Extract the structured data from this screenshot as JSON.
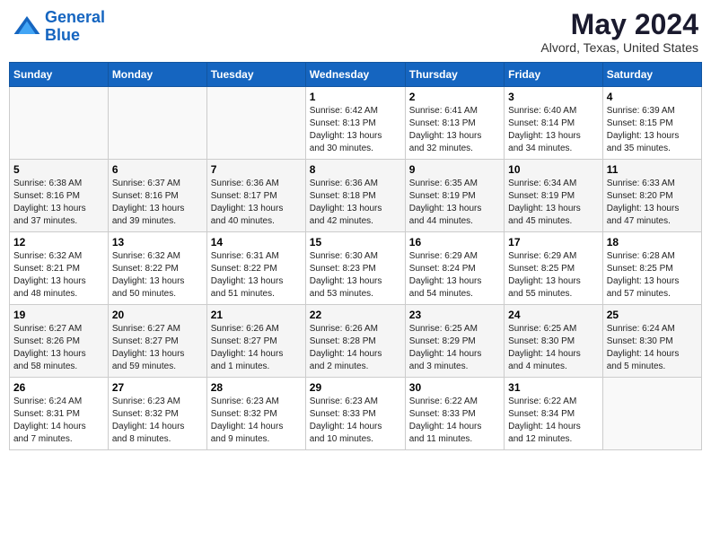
{
  "header": {
    "logo_line1": "General",
    "logo_line2": "Blue",
    "month_title": "May 2024",
    "location": "Alvord, Texas, United States"
  },
  "days_of_week": [
    "Sunday",
    "Monday",
    "Tuesday",
    "Wednesday",
    "Thursday",
    "Friday",
    "Saturday"
  ],
  "weeks": [
    [
      {
        "day": "",
        "info": ""
      },
      {
        "day": "",
        "info": ""
      },
      {
        "day": "",
        "info": ""
      },
      {
        "day": "1",
        "info": "Sunrise: 6:42 AM\nSunset: 8:13 PM\nDaylight: 13 hours\nand 30 minutes."
      },
      {
        "day": "2",
        "info": "Sunrise: 6:41 AM\nSunset: 8:13 PM\nDaylight: 13 hours\nand 32 minutes."
      },
      {
        "day": "3",
        "info": "Sunrise: 6:40 AM\nSunset: 8:14 PM\nDaylight: 13 hours\nand 34 minutes."
      },
      {
        "day": "4",
        "info": "Sunrise: 6:39 AM\nSunset: 8:15 PM\nDaylight: 13 hours\nand 35 minutes."
      }
    ],
    [
      {
        "day": "5",
        "info": "Sunrise: 6:38 AM\nSunset: 8:16 PM\nDaylight: 13 hours\nand 37 minutes."
      },
      {
        "day": "6",
        "info": "Sunrise: 6:37 AM\nSunset: 8:16 PM\nDaylight: 13 hours\nand 39 minutes."
      },
      {
        "day": "7",
        "info": "Sunrise: 6:36 AM\nSunset: 8:17 PM\nDaylight: 13 hours\nand 40 minutes."
      },
      {
        "day": "8",
        "info": "Sunrise: 6:36 AM\nSunset: 8:18 PM\nDaylight: 13 hours\nand 42 minutes."
      },
      {
        "day": "9",
        "info": "Sunrise: 6:35 AM\nSunset: 8:19 PM\nDaylight: 13 hours\nand 44 minutes."
      },
      {
        "day": "10",
        "info": "Sunrise: 6:34 AM\nSunset: 8:19 PM\nDaylight: 13 hours\nand 45 minutes."
      },
      {
        "day": "11",
        "info": "Sunrise: 6:33 AM\nSunset: 8:20 PM\nDaylight: 13 hours\nand 47 minutes."
      }
    ],
    [
      {
        "day": "12",
        "info": "Sunrise: 6:32 AM\nSunset: 8:21 PM\nDaylight: 13 hours\nand 48 minutes."
      },
      {
        "day": "13",
        "info": "Sunrise: 6:32 AM\nSunset: 8:22 PM\nDaylight: 13 hours\nand 50 minutes."
      },
      {
        "day": "14",
        "info": "Sunrise: 6:31 AM\nSunset: 8:22 PM\nDaylight: 13 hours\nand 51 minutes."
      },
      {
        "day": "15",
        "info": "Sunrise: 6:30 AM\nSunset: 8:23 PM\nDaylight: 13 hours\nand 53 minutes."
      },
      {
        "day": "16",
        "info": "Sunrise: 6:29 AM\nSunset: 8:24 PM\nDaylight: 13 hours\nand 54 minutes."
      },
      {
        "day": "17",
        "info": "Sunrise: 6:29 AM\nSunset: 8:25 PM\nDaylight: 13 hours\nand 55 minutes."
      },
      {
        "day": "18",
        "info": "Sunrise: 6:28 AM\nSunset: 8:25 PM\nDaylight: 13 hours\nand 57 minutes."
      }
    ],
    [
      {
        "day": "19",
        "info": "Sunrise: 6:27 AM\nSunset: 8:26 PM\nDaylight: 13 hours\nand 58 minutes."
      },
      {
        "day": "20",
        "info": "Sunrise: 6:27 AM\nSunset: 8:27 PM\nDaylight: 13 hours\nand 59 minutes."
      },
      {
        "day": "21",
        "info": "Sunrise: 6:26 AM\nSunset: 8:27 PM\nDaylight: 14 hours\nand 1 minutes."
      },
      {
        "day": "22",
        "info": "Sunrise: 6:26 AM\nSunset: 8:28 PM\nDaylight: 14 hours\nand 2 minutes."
      },
      {
        "day": "23",
        "info": "Sunrise: 6:25 AM\nSunset: 8:29 PM\nDaylight: 14 hours\nand 3 minutes."
      },
      {
        "day": "24",
        "info": "Sunrise: 6:25 AM\nSunset: 8:30 PM\nDaylight: 14 hours\nand 4 minutes."
      },
      {
        "day": "25",
        "info": "Sunrise: 6:24 AM\nSunset: 8:30 PM\nDaylight: 14 hours\nand 5 minutes."
      }
    ],
    [
      {
        "day": "26",
        "info": "Sunrise: 6:24 AM\nSunset: 8:31 PM\nDaylight: 14 hours\nand 7 minutes."
      },
      {
        "day": "27",
        "info": "Sunrise: 6:23 AM\nSunset: 8:32 PM\nDaylight: 14 hours\nand 8 minutes."
      },
      {
        "day": "28",
        "info": "Sunrise: 6:23 AM\nSunset: 8:32 PM\nDaylight: 14 hours\nand 9 minutes."
      },
      {
        "day": "29",
        "info": "Sunrise: 6:23 AM\nSunset: 8:33 PM\nDaylight: 14 hours\nand 10 minutes."
      },
      {
        "day": "30",
        "info": "Sunrise: 6:22 AM\nSunset: 8:33 PM\nDaylight: 14 hours\nand 11 minutes."
      },
      {
        "day": "31",
        "info": "Sunrise: 6:22 AM\nSunset: 8:34 PM\nDaylight: 14 hours\nand 12 minutes."
      },
      {
        "day": "",
        "info": ""
      }
    ]
  ]
}
